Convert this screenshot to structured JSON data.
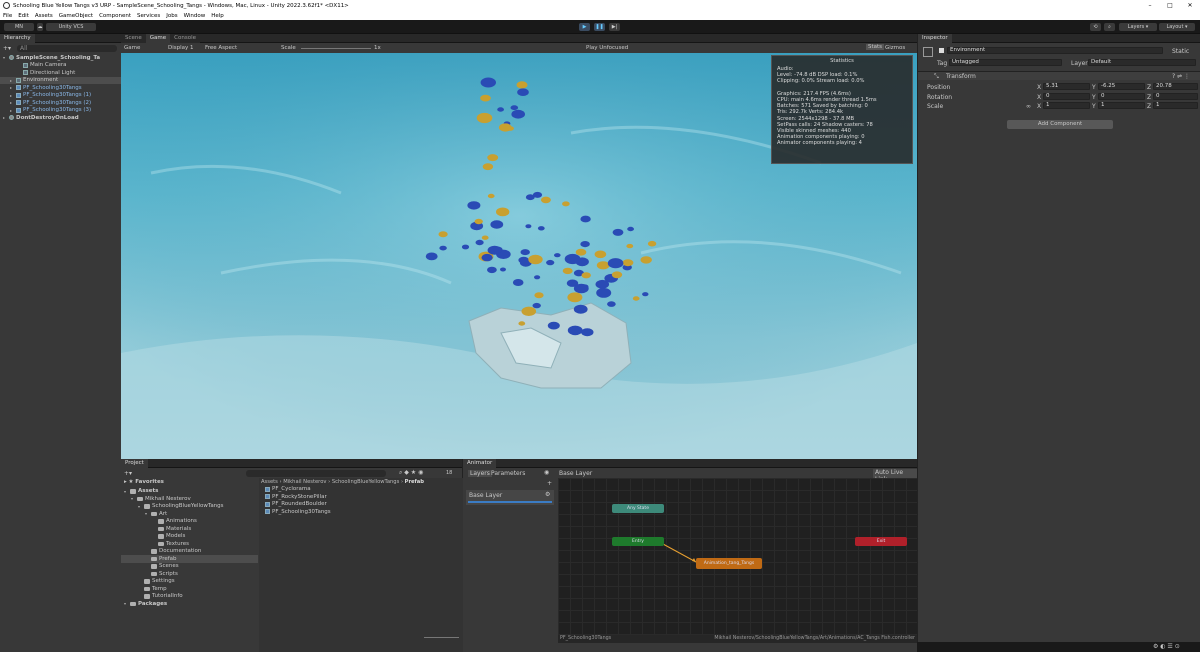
{
  "window": {
    "title": "Schooling Blue Yellow Tangs v3 URP - SampleScene_Schooling_Tangs - Windows, Mac, Linux - Unity 2022.3.62f1* <DX11>",
    "min": "–",
    "max": "□",
    "close": "✕"
  },
  "menu": [
    "File",
    "Edit",
    "Assets",
    "GameObject",
    "Component",
    "Services",
    "Jobs",
    "Window",
    "Help"
  ],
  "toolbar": {
    "account": "MN",
    "vcs": "Unity VCS",
    "layers": "Layers",
    "layout": "Layout"
  },
  "hierarchy": {
    "tab": "Hierarchy",
    "search_placeholder": "All",
    "items": [
      {
        "label": "SampleScene_Schooling_Ta",
        "indent": 0,
        "kind": "scene",
        "expanded": true
      },
      {
        "label": "Main Camera",
        "indent": 2,
        "kind": "go"
      },
      {
        "label": "Directional Light",
        "indent": 2,
        "kind": "go"
      },
      {
        "label": "Environment",
        "indent": 1,
        "kind": "go",
        "selected": true
      },
      {
        "label": "PF_Schooling30Tangs",
        "indent": 1,
        "kind": "prefab"
      },
      {
        "label": "PF_Schooling30Tangs (1)",
        "indent": 1,
        "kind": "prefab"
      },
      {
        "label": "PF_Schooling30Tangs (2)",
        "indent": 1,
        "kind": "prefab"
      },
      {
        "label": "PF_Schooling30Tangs (3)",
        "indent": 1,
        "kind": "prefab"
      },
      {
        "label": "DontDestroyOnLoad",
        "indent": 0,
        "kind": "scene"
      }
    ]
  },
  "scene_tabs": [
    "Scene",
    "Game",
    "Console"
  ],
  "game_bar": {
    "mode": "Game",
    "display": "Display 1",
    "aspect": "Free Aspect",
    "scale_label": "Scale",
    "scale_value": "1x",
    "play_focus": "Play Unfocused",
    "stats": "Stats",
    "gizmos": "Gizmos"
  },
  "stats": {
    "title": "Statistics",
    "lines": [
      "Audio:",
      "Level: -74.8 dB                DSP load: 0.1%",
      "Clipping: 0.0%                  Stream load: 0.0%",
      "",
      "Graphics:                                  217.4 FPS (4.6ms)",
      "CPU: main 4.6ms  render thread 1.5ms",
      "Batches: 571     Saved by batching: 0",
      "Tris: 292.7k       Verts: 284.4k",
      "Screen: 2544x1298 - 37.8 MB",
      "SetPass calls: 24       Shadow casters: 78",
      "Visible skinned meshes: 440",
      "Animation components playing: 0",
      "Animator components playing: 4"
    ]
  },
  "inspector": {
    "tab": "Inspector",
    "object_name": "Environment",
    "static_label": "Static",
    "tag_label": "Tag",
    "tag_value": "Untagged",
    "layer_label": "Layer",
    "layer_value": "Default",
    "component": "Transform",
    "position": {
      "label": "Position",
      "x": "5.31",
      "y": "-6.25",
      "z": "20.78"
    },
    "rotation": {
      "label": "Rotation",
      "x": "0",
      "y": "0",
      "z": "0"
    },
    "scale": {
      "label": "Scale",
      "x": "1",
      "y": "1",
      "z": "1"
    },
    "add_component": "Add Component"
  },
  "project": {
    "tab": "Project",
    "favorites": "Favorites",
    "count": "18",
    "breadcrumb": [
      "Assets",
      "Mikhail Nesterov",
      "SchoolingBlueYellowTangs",
      "Prefab"
    ],
    "tree": [
      {
        "label": "Assets",
        "indent": 0,
        "bold": true
      },
      {
        "label": "Mikhail Nesterov",
        "indent": 1
      },
      {
        "label": "SchoolingBlueYellowTangs",
        "indent": 2
      },
      {
        "label": "Art",
        "indent": 3
      },
      {
        "label": "Animations",
        "indent": 4
      },
      {
        "label": "Materials",
        "indent": 4
      },
      {
        "label": "Models",
        "indent": 4
      },
      {
        "label": "Textures",
        "indent": 4
      },
      {
        "label": "Documentation",
        "indent": 3
      },
      {
        "label": "Prefab",
        "indent": 3,
        "selected": true
      },
      {
        "label": "Scenes",
        "indent": 3
      },
      {
        "label": "Scripts",
        "indent": 3
      },
      {
        "label": "Settings",
        "indent": 2
      },
      {
        "label": "Temp",
        "indent": 2
      },
      {
        "label": "TutorialInfo",
        "indent": 2
      },
      {
        "label": "Packages",
        "indent": 0,
        "bold": true
      }
    ],
    "files": [
      "PF_Cyclorama",
      "PF_RockyStonePillar",
      "PF_RoundedBoulder",
      "PF_Schooling30Tangs"
    ]
  },
  "animator": {
    "tab": "Animator",
    "subtabs": [
      "Layers",
      "Parameters"
    ],
    "layer_header": "Base Layer",
    "layer_item": "Base Layer",
    "live_link": "Auto Live Link",
    "nodes": {
      "any": "Any State",
      "entry": "Entry",
      "exit": "Exit",
      "state": "Animation_tang_Tangs"
    },
    "footer_left": "PF_Schooling30Tangs",
    "footer_right": "Mikhail Nesterov/SchoolingBlueYellowTangs/Art/Animations/AC_Tangs Fish.controller"
  },
  "colors": {
    "selection": "#2c5d87",
    "entry": "#1e7a2c",
    "exit": "#b0202a",
    "state": "#c06a14",
    "anystate": "#3d8a7a"
  }
}
